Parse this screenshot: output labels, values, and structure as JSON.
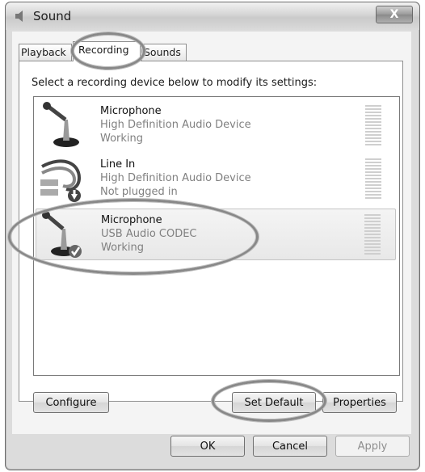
{
  "window": {
    "title": "Sound",
    "close_glyph": "X"
  },
  "tabs": [
    {
      "label": "Playback"
    },
    {
      "label": "Recording"
    },
    {
      "label": "Sounds"
    }
  ],
  "instruction": "Select a recording device below to modify its settings:",
  "devices": [
    {
      "name": "Microphone",
      "line1": "High Definition Audio Device",
      "line2": "Working",
      "icon": "microphone-icon",
      "selected": false
    },
    {
      "name": "Line In",
      "line1": "High Definition Audio Device",
      "line2": "Not plugged in",
      "icon": "line-in-cable-icon",
      "badge": "down-arrow-badge-icon",
      "selected": false
    },
    {
      "name": "Microphone",
      "line1": "USB Audio CODEC",
      "line2": "Working",
      "icon": "microphone-icon",
      "badge": "checkmark-badge-icon",
      "selected": true
    }
  ],
  "buttons": {
    "configure": "Configure",
    "set_default": "Set Default",
    "properties": "Properties",
    "ok": "OK",
    "cancel": "Cancel",
    "apply": "Apply"
  },
  "colors": {
    "highlight_ring": "#888888",
    "selected_row": "#ececec"
  }
}
